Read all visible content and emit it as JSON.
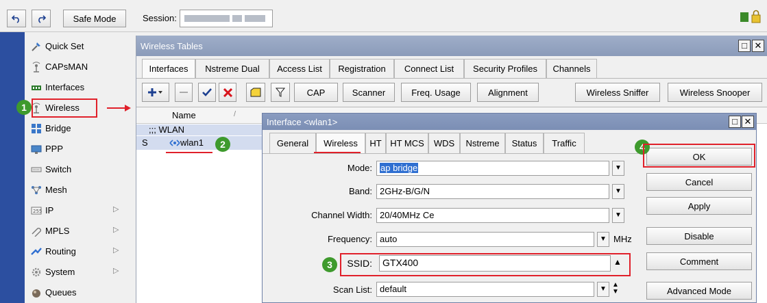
{
  "toolbar": {
    "safe_mode": "Safe Mode",
    "session_label": "Session:"
  },
  "sidebar": {
    "items": [
      {
        "label": "Quick Set",
        "icon": "quick-set-icon",
        "submenu": false
      },
      {
        "label": "CAPsMAN",
        "icon": "capsman-icon",
        "submenu": false
      },
      {
        "label": "Interfaces",
        "icon": "interfaces-icon",
        "submenu": false
      },
      {
        "label": "Wireless",
        "icon": "wireless-icon",
        "submenu": false
      },
      {
        "label": "Bridge",
        "icon": "bridge-icon",
        "submenu": false
      },
      {
        "label": "PPP",
        "icon": "ppp-icon",
        "submenu": false
      },
      {
        "label": "Switch",
        "icon": "switch-icon",
        "submenu": false
      },
      {
        "label": "Mesh",
        "icon": "mesh-icon",
        "submenu": false
      },
      {
        "label": "IP",
        "icon": "ip-icon",
        "submenu": true
      },
      {
        "label": "MPLS",
        "icon": "mpls-icon",
        "submenu": true
      },
      {
        "label": "Routing",
        "icon": "routing-icon",
        "submenu": true
      },
      {
        "label": "System",
        "icon": "system-icon",
        "submenu": true
      },
      {
        "label": "Queues",
        "icon": "queues-icon",
        "submenu": false
      }
    ]
  },
  "wireless_tables": {
    "title": "Wireless Tables",
    "tabs": [
      "Interfaces",
      "Nstreme Dual",
      "Access List",
      "Registration",
      "Connect List",
      "Security Profiles",
      "Channels"
    ],
    "active_tab": "Interfaces",
    "buttons": [
      "CAP",
      "Scanner",
      "Freq. Usage",
      "Alignment",
      "Wireless Sniffer",
      "Wireless Snooper"
    ],
    "list": {
      "column_name": "Name",
      "group": ";;; WLAN",
      "rows": [
        {
          "flag": "S",
          "name": "wlan1"
        }
      ]
    }
  },
  "dialog": {
    "title": "Interface <wlan1>",
    "tabs": [
      "General",
      "Wireless",
      "HT",
      "HT MCS",
      "WDS",
      "Nstreme",
      "Status",
      "Traffic"
    ],
    "active_tab": "Wireless",
    "fields": {
      "mode": {
        "label": "Mode:",
        "value": "ap bridge"
      },
      "band": {
        "label": "Band:",
        "value": "2GHz-B/G/N"
      },
      "channel_width": {
        "label": "Channel Width:",
        "value": "20/40MHz Ce"
      },
      "frequency": {
        "label": "Frequency:",
        "value": "auto",
        "unit": "MHz"
      },
      "ssid": {
        "label": "SSID:",
        "value": "GTX400"
      },
      "scan_list": {
        "label": "Scan List:",
        "value": "default"
      }
    },
    "buttons": [
      "OK",
      "Cancel",
      "Apply",
      "Disable",
      "Comment",
      "Advanced Mode"
    ]
  },
  "annotations": {
    "step1": "1",
    "step2": "2",
    "step3": "3",
    "step4": "4",
    "color": "#e0202a",
    "badge_color": "#3e9a2d"
  },
  "colors": {
    "sidebar_strip": "#2c4fa0",
    "window_title": "#9faec9",
    "selection": "#2f6fd1"
  }
}
